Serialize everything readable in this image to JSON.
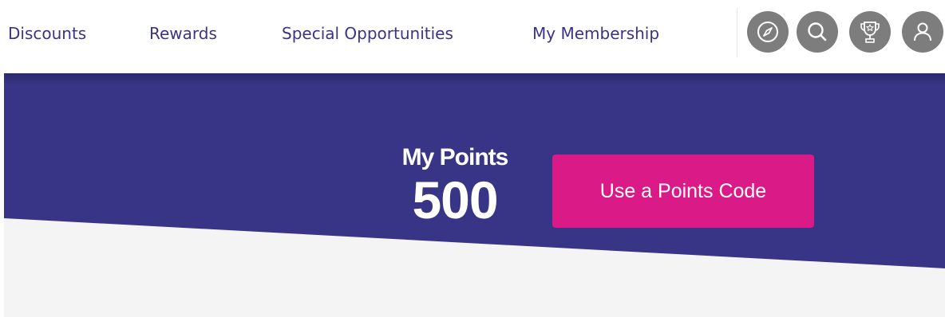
{
  "nav": {
    "links": [
      "Discounts",
      "Rewards",
      "Special Opportunities",
      "My Membership"
    ],
    "icons": [
      "compass-icon",
      "search-icon",
      "trophy-icon",
      "user-icon"
    ]
  },
  "points": {
    "label": "My Points",
    "value": "500",
    "button_label": "Use a Points Code"
  },
  "colors": {
    "nav_text": "#3a3486",
    "hero_band": "#383586",
    "accent_button": "#da1a86",
    "icon_bg": "#7d7d7d",
    "hero_bg": "#f4f4f4"
  }
}
